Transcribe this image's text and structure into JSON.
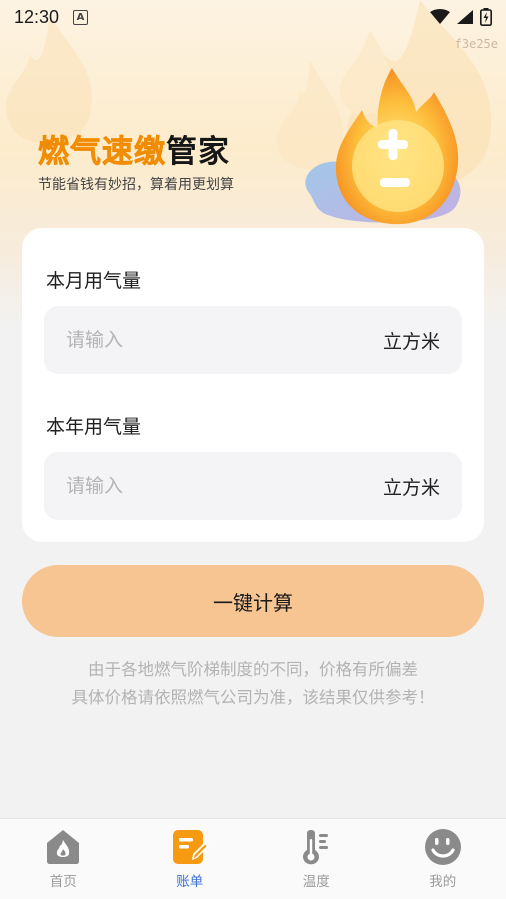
{
  "status_bar": {
    "time": "12:30",
    "notification_icon": "A"
  },
  "build_code": "f3e25e",
  "header": {
    "title_highlight": "燃气速缴",
    "title_rest": "管家",
    "subtitle": "节能省钱有妙招，算着用更划算"
  },
  "form": {
    "monthly": {
      "label": "本月用气量",
      "placeholder": "请输入",
      "value": "",
      "unit": "立方米"
    },
    "yearly": {
      "label": "本年用气量",
      "placeholder": "请输入",
      "value": "",
      "unit": "立方米"
    }
  },
  "calculate_button": "一键计算",
  "disclaimer": {
    "line1": "由于各地燃气阶梯制度的不同，价格有所偏差",
    "line2": "具体价格请依照燃气公司为准，该结果仅供参考！"
  },
  "tabs": [
    {
      "label": "首页",
      "icon": "home-flame-icon",
      "active": false
    },
    {
      "label": "账单",
      "icon": "bill-edit-icon",
      "active": true
    },
    {
      "label": "温度",
      "icon": "thermometer-icon",
      "active": false
    },
    {
      "label": "我的",
      "icon": "smiley-profile-icon",
      "active": false
    }
  ],
  "colors": {
    "accent": "#f59a11",
    "button": "#f7c591",
    "active_tab": "#3a6fd8",
    "inactive_tab_icon": "#8a8a8a"
  }
}
